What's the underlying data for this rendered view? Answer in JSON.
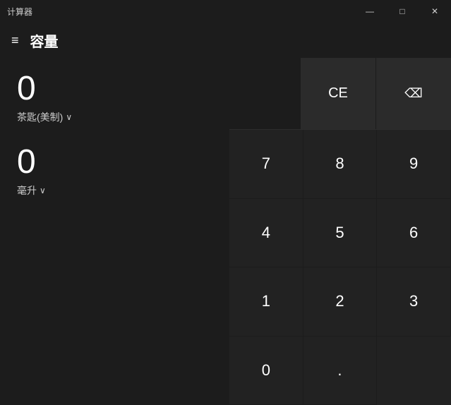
{
  "titleBar": {
    "title": "计算器",
    "minimize": "—",
    "maximize": "□",
    "close": "✕"
  },
  "header": {
    "title": "容量",
    "hamburger": "≡"
  },
  "leftPanel": {
    "inputValue": "0",
    "inputUnit": "茶匙(美制)",
    "outputValue": "0",
    "outputUnit": "毫升",
    "chevron": "∨"
  },
  "topButtons": {
    "ce": "CE",
    "backspace": "⌫"
  },
  "numpad": {
    "buttons": [
      "7",
      "8",
      "9",
      "4",
      "5",
      "6",
      "1",
      "2",
      "3",
      "0",
      "."
    ]
  }
}
